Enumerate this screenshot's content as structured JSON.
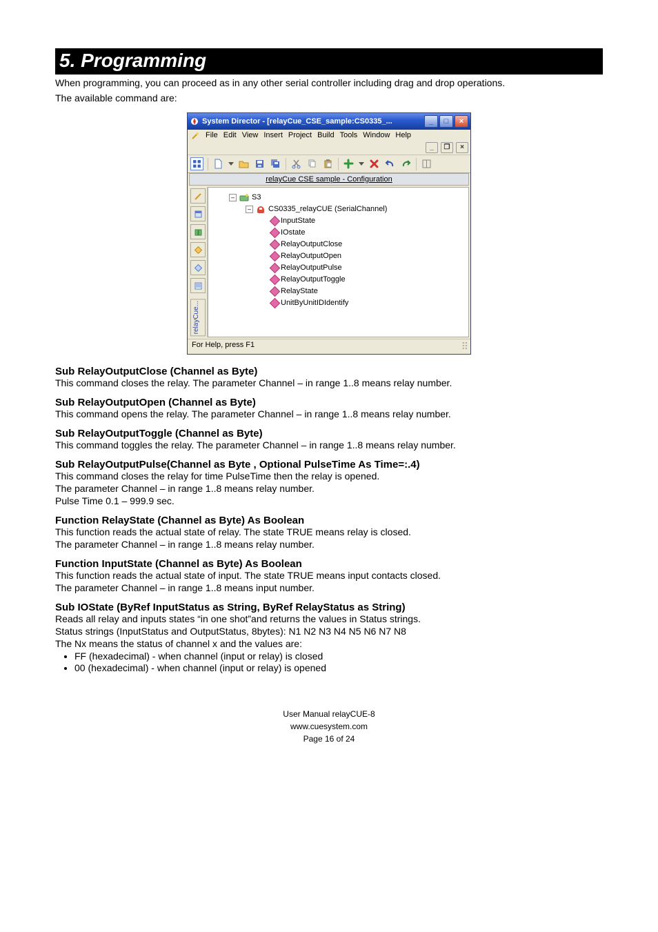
{
  "doc": {
    "section_title": "5. Programming",
    "intro1": "When programming, you can proceed as in any other serial controller including drag and drop operations.",
    "intro2": "The available command are:"
  },
  "win": {
    "title": "System Director - [relayCue_CSE_sample:CS0335_...",
    "menus": [
      "File",
      "Edit",
      "View",
      "Insert",
      "Project",
      "Build",
      "Tools",
      "Window",
      "Help"
    ],
    "subheader": "relayCue  CSE  sample - Configuration",
    "tree": {
      "root": "S3",
      "channel": "CS0335_relayCUE (SerialChannel)",
      "items": [
        "InputState",
        "IOstate",
        "RelayOutputClose",
        "RelayOutputOpen",
        "RelayOutputPulse",
        "RelayOutputToggle",
        "RelayState",
        "UnitByUnitIDIdentify"
      ]
    },
    "side_label": "relayCue...",
    "status": "For Help, press F1"
  },
  "cmds": [
    {
      "h": "Sub RelayOutputClose (Channel as Byte)",
      "d": [
        "This command closes the relay. The parameter  Channel – in range 1..8 means relay number."
      ]
    },
    {
      "h": "Sub RelayOutputOpen (Channel as Byte)",
      "d": [
        "This command opens the relay. The parameter  Channel – in range 1..8 means relay number."
      ]
    },
    {
      "h": "Sub RelayOutputToggle (Channel as Byte)",
      "d": [
        "This command toggles the relay. The parameter  Channel – in range 1..8 means relay number."
      ]
    },
    {
      "h": "Sub RelayOutputPulse(Channel as Byte , Optional PulseTime As Time=:.4)",
      "d": [
        "This command closes the relay for time PulseTime then the relay is opened.",
        "The parameter  Channel – in range 1..8 means relay number.",
        "Pulse Time 0.1 – 999.9 sec."
      ]
    },
    {
      "h": "Function RelayState (Channel as Byte) As Boolean",
      "d": [
        "This function reads the actual state of relay. The state TRUE means relay is closed.",
        "The parameter  Channel – in range 1..8 means relay number."
      ]
    },
    {
      "h": "Function InputState (Channel as Byte) As Boolean",
      "d": [
        "This function reads the actual state of input. The state TRUE means input contacts closed.",
        "The parameter  Channel – in range 1..8 means input number."
      ]
    },
    {
      "h": "Sub IOState (ByRef InputStatus as String, ByRef RelayStatus as String)",
      "d": [
        "Reads all relay and inputs states “in one shot”and returns the values in Status strings.",
        "Status strings (InputStatus and OutputStatus, 8bytes):  N1  N2  N3  N4  N5  N6  N7  N8",
        "The Nx means the status of channel x and the values are:"
      ],
      "ul": [
        "FF (hexadecimal) - when channel (input or relay) is closed",
        "00 (hexadecimal) - when channel (input or relay) is opened"
      ]
    }
  ],
  "footer": {
    "l1": "User Manual relayCUE-8",
    "l2": "www.cuesystem.com",
    "l3": "Page 16 of 24"
  }
}
